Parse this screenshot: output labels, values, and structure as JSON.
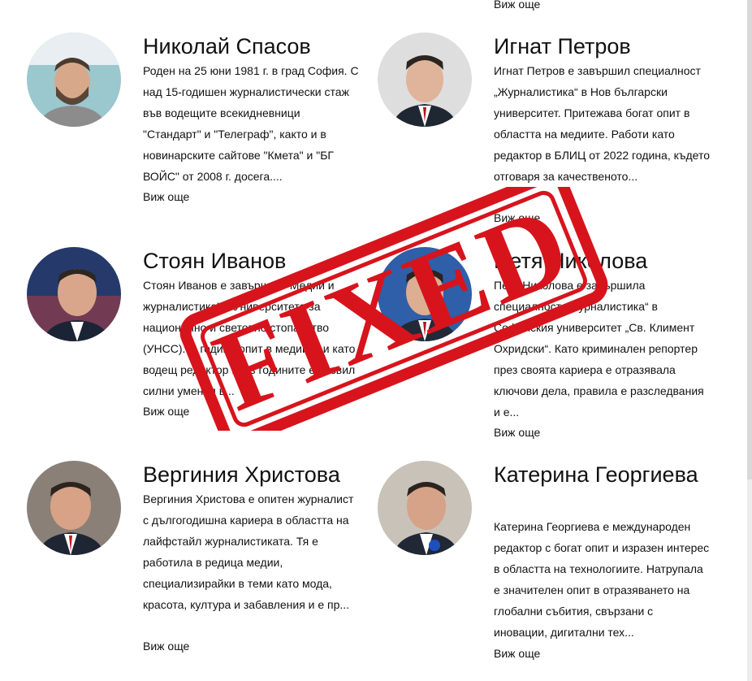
{
  "top_more": "Виж още",
  "authors": [
    {
      "name": "Николай Спасов",
      "bio": "Роден на 25 юни 1981 г. в град София. С над 15-годишен журналистически стаж във водещите всекидневници \"Стандарт\" и \"Телеграф\", както и в новинарските сайтове \"Кмета\" и \"БГ ВОЙС\" от 2008 г. досега....",
      "more": "Виж още",
      "avatar_bg": "#9bc7cf"
    },
    {
      "name": "Игнат Петров",
      "bio": "Игнат Петров е завършил специалност „Журналистика“ в Нов български университет. Притежава богат опит в областта на медиите. Работи като редактор в БЛИЦ от 2022 година, където отговаря за качественото...",
      "more": "Виж още",
      "avatar_bg": "#dedede"
    },
    {
      "name": "Стоян Иванов",
      "bio": "Стоян Иванов е завършил \"Медии и журналистика\" в Университета за национално и световно стопанство (УНСС). С години опит в медиите и като водещ редактор през годините е развил силни умения в...",
      "more": "Виж още",
      "avatar_bg": "#253a6b"
    },
    {
      "name": "Петя Николова",
      "bio": "Петя Николова е завършила специалност „Журналистика“ в Софийския университет „Св. Климент Охридски“. Като криминален репортер през своята кариера е отразявала ключови дела, правила е разследвания и е...",
      "more": "Виж още",
      "avatar_bg": "#2f5fa8"
    },
    {
      "name": "Вергиния Христова",
      "bio": "Вергиния Христова е опитен журналист с дългогодишна кариера в областта на лайфстайл журналистиката. Тя е работила в редица медии, специализирайки в теми като мода, красота, култура и забавления и е пр...",
      "more": "Виж още",
      "avatar_bg": "#8a8077"
    },
    {
      "name": "Катерина Георгиева",
      "bio": "Катерина Георгиева е международен редактор с богат опит и изразен интерес в областта на технологиите. Натрупала е значителен опит в отразяването на глобални събития, свързани с иновации, дигитални тех...",
      "more": "Виж още",
      "avatar_bg": "#c9c2b8"
    }
  ],
  "stamp": {
    "text": "FIXED",
    "color": "#d7141c"
  }
}
